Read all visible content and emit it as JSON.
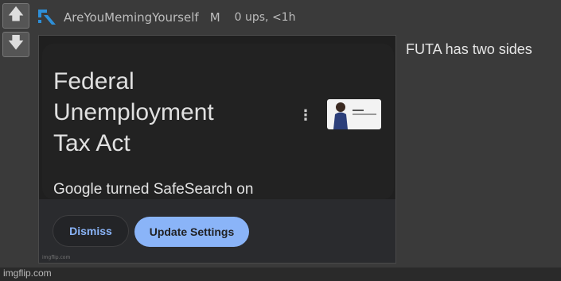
{
  "post": {
    "username": "AreYouMemingYourself",
    "mod_badge": "M",
    "stats": "0 ups, <1h",
    "caption": "FUTA has two sides"
  },
  "vote": {
    "up_icon": "arrow-up-icon",
    "down_icon": "arrow-down-icon"
  },
  "image": {
    "title": "Federal\nUnemployment\nTax Act",
    "thumb_label": "FUTA",
    "safesearch_message": "Google turned SafeSearch on",
    "dismiss_label": "Dismiss",
    "update_label": "Update Settings",
    "inner_watermark": "imgflip.com"
  },
  "footer": {
    "watermark": "imgflip.com"
  },
  "colors": {
    "accent_blue": "#8ab4f8",
    "logo_blue": "#2e8fd8"
  }
}
